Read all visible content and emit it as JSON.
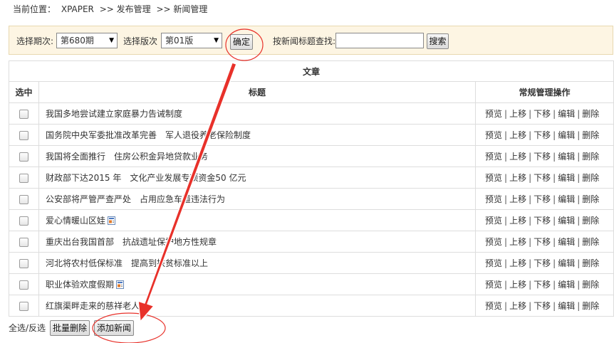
{
  "breadcrumb": {
    "prefix": "当前位置：",
    "items": [
      "XPAPER",
      ">> 发布管理",
      ">> 新闻管理"
    ]
  },
  "toolbar": {
    "period_label": "选择期次:",
    "period_value": "第680期",
    "edition_label": "选择版次",
    "edition_value": "第01版",
    "confirm_label": "确定",
    "search_label": "按新闻标题查找:",
    "search_value": "",
    "search_button": "搜索"
  },
  "table": {
    "caption": "文章",
    "columns": [
      "选中",
      "标题",
      "常规管理操作"
    ],
    "actions": [
      "预览",
      "上移",
      "下移",
      "编辑",
      "删除"
    ],
    "rows": [
      {
        "title": "我国多地尝试建立家庭暴力告诫制度"
      },
      {
        "title": "国务院中央军委批准改革完善　军人退役养老保险制度"
      },
      {
        "title": "我国将全面推行　住房公积金异地贷款业务"
      },
      {
        "title": "财政部下达2015 年　文化产业发展专项资金50 亿元"
      },
      {
        "title": "公安部将严管严查严处　占用应急车道违法行为"
      },
      {
        "title": "爱心情暖山区娃",
        "icon": "document-icon"
      },
      {
        "title": "重庆出台我国首部　抗战遗址保护地方性规章"
      },
      {
        "title": "河北将农村低保标准　提高到扶贫标准以上"
      },
      {
        "title": "职业体验欢度假期",
        "icon": "document-icon"
      },
      {
        "title": "红旗渠畔走来的慈祥老人"
      }
    ]
  },
  "footer": {
    "select_all_label": "全选/反选",
    "batch_delete_label": "批量删除",
    "add_news_label": "添加新闻"
  },
  "annotation": {
    "color": "#e8312a"
  }
}
